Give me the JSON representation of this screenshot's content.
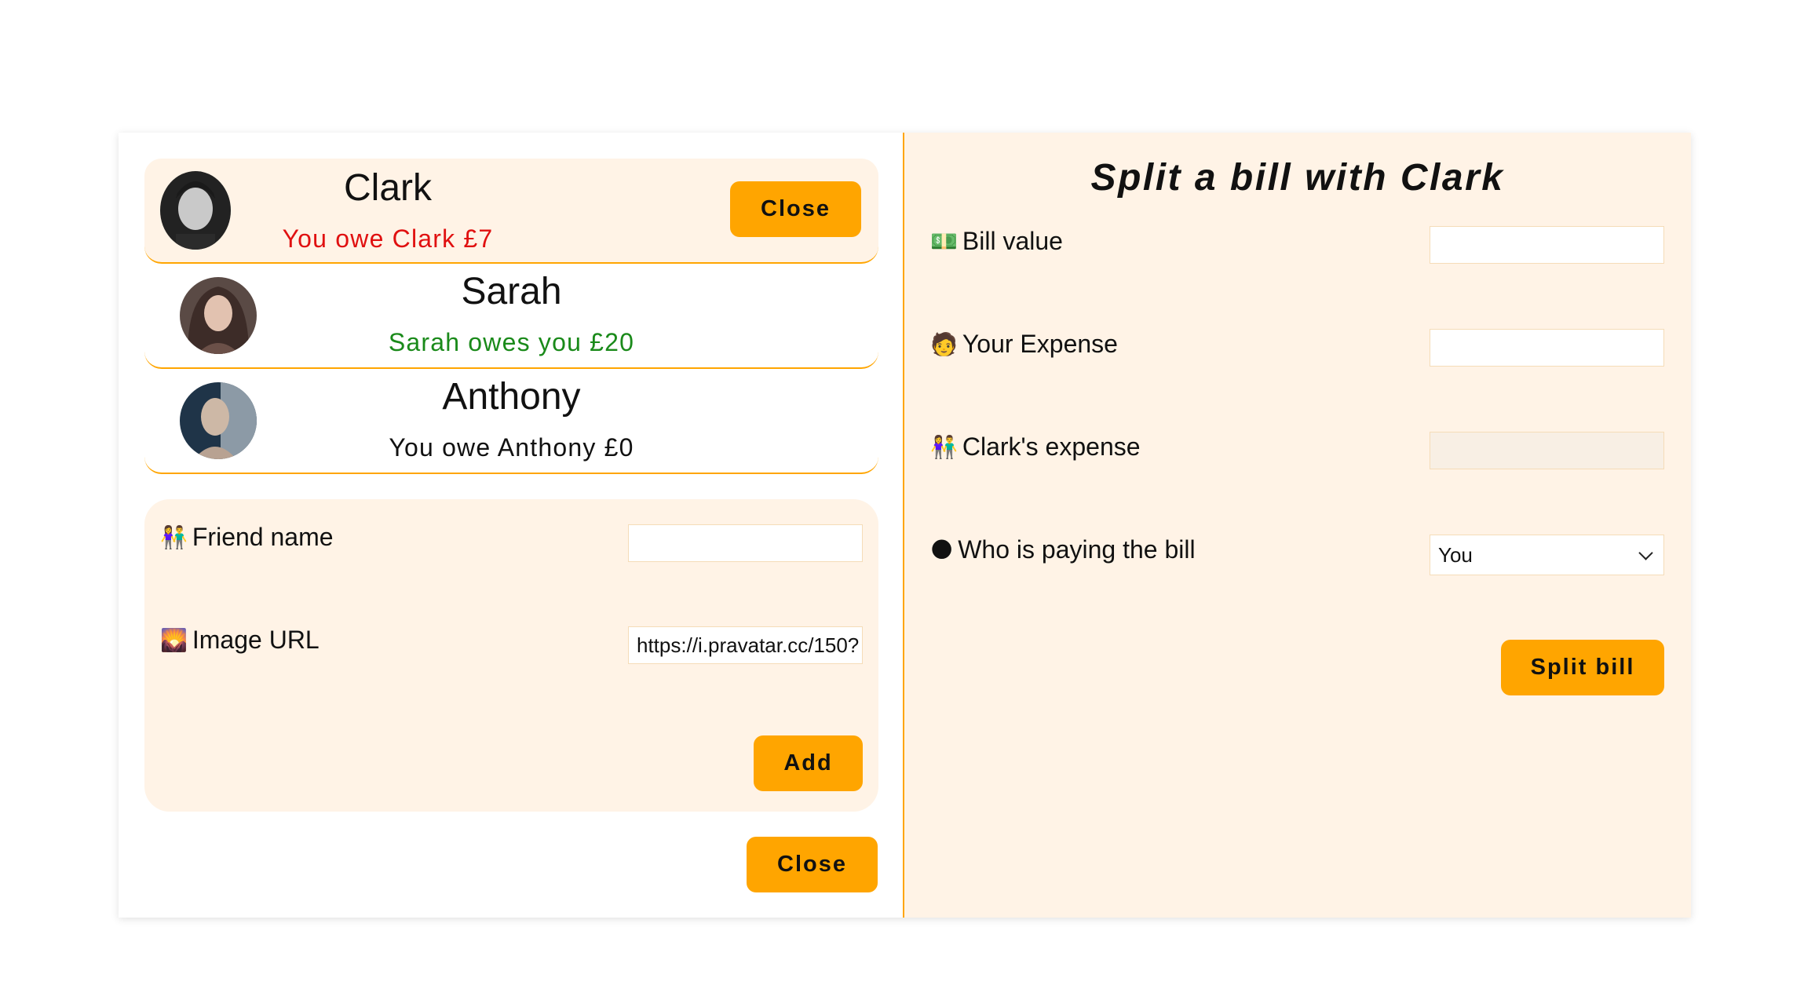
{
  "friends": [
    {
      "name": "Clark",
      "balance": "You owe Clark £7",
      "balance_color": "#e01010",
      "selected": true,
      "button": "Close"
    },
    {
      "name": "Sarah",
      "balance": "Sarah owes you £20",
      "balance_color": "#1a8a1a",
      "selected": false
    },
    {
      "name": "Anthony",
      "balance": "You owe Anthony £0",
      "balance_color": "#111111",
      "selected": false
    }
  ],
  "add_form": {
    "friend_name_label": "Friend name",
    "friend_name_icon": "people-holding-hands-icon",
    "friend_name_value": "",
    "image_url_label": "Image URL",
    "image_url_icon": "sunrise-picture-icon",
    "image_url_value": "https://i.pravatar.cc/150?",
    "add_button": "Add"
  },
  "close_button": "Close",
  "split_form": {
    "title": "Split a bill with Clark",
    "bill_value_label": "Bill value",
    "bill_value_icon": "money-bill-icon",
    "bill_value": "",
    "your_expense_label": "Your Expense",
    "your_expense_icon": "person-icon",
    "your_expense": "",
    "friend_expense_label": "Clark's expense",
    "friend_expense_icon": "people-holding-hands-icon",
    "friend_expense": "",
    "payer_label": "Who is paying the bill",
    "payer_icon": "moon-icon",
    "payer_value": "You",
    "split_button": "Split bill"
  },
  "colors": {
    "accent": "#ffa500",
    "panel_bg": "#fff3e6",
    "owe_red": "#e01010",
    "owed_green": "#1a8a1a"
  }
}
